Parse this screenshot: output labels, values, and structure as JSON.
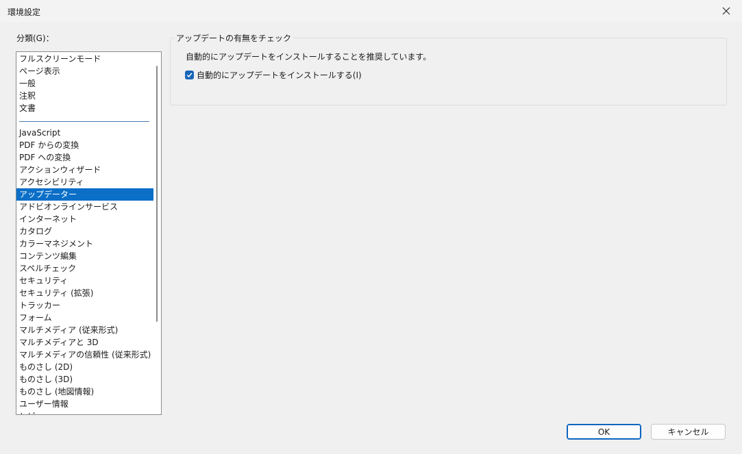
{
  "window": {
    "title": "環境設定"
  },
  "sidebar": {
    "label": "分類(G)：",
    "items": [
      {
        "label": "フルスクリーンモード",
        "selected": false
      },
      {
        "label": "ページ表示",
        "selected": false
      },
      {
        "label": "一般",
        "selected": false
      },
      {
        "label": "注釈",
        "selected": false
      },
      {
        "label": "文書",
        "selected": false
      },
      {
        "label": "",
        "separator": true
      },
      {
        "label": "JavaScript",
        "selected": false
      },
      {
        "label": "PDF からの変換",
        "selected": false
      },
      {
        "label": "PDF への変換",
        "selected": false
      },
      {
        "label": "アクションウィザード",
        "selected": false
      },
      {
        "label": "アクセシビリティ",
        "selected": false
      },
      {
        "label": "アップデーター",
        "selected": true
      },
      {
        "label": "アドビオンラインサービス",
        "selected": false
      },
      {
        "label": "インターネット",
        "selected": false
      },
      {
        "label": "カタログ",
        "selected": false
      },
      {
        "label": "カラーマネジメント",
        "selected": false
      },
      {
        "label": "コンテンツ編集",
        "selected": false
      },
      {
        "label": "スペルチェック",
        "selected": false
      },
      {
        "label": "セキュリティ",
        "selected": false
      },
      {
        "label": "セキュリティ (拡張)",
        "selected": false
      },
      {
        "label": "トラッカー",
        "selected": false
      },
      {
        "label": "フォーム",
        "selected": false
      },
      {
        "label": "マルチメディア (従来形式)",
        "selected": false
      },
      {
        "label": "マルチメディアと 3D",
        "selected": false
      },
      {
        "label": "マルチメディアの信頼性 (従来形式)",
        "selected": false
      },
      {
        "label": "ものさし (2D)",
        "selected": false
      },
      {
        "label": "ものさし (3D)",
        "selected": false
      },
      {
        "label": "ものさし (地図情報)",
        "selected": false
      },
      {
        "label": "ユーザー情報",
        "selected": false
      },
      {
        "label": "レビュー",
        "selected": false
      }
    ]
  },
  "updates": {
    "group_title": "アップデートの有無をチェック",
    "description": "自動的にアップデートをインストールすることを推奨しています。",
    "auto_install_label": "自動的にアップデートをインストールする(I)",
    "auto_install_checked": true
  },
  "buttons": {
    "ok": "OK",
    "cancel": "キャンセル"
  },
  "colors": {
    "accent": "#0b6fc7",
    "checkbox": "#1966b8"
  }
}
